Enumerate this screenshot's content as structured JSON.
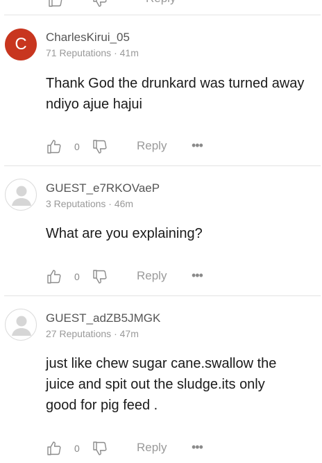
{
  "previous_comment": {
    "reply_label": "Reply"
  },
  "comments": [
    {
      "avatar_letter": "C",
      "avatar_color": "#c8361f",
      "username": "CharlesKirui_05",
      "meta": "71 Reputations · 41m",
      "text_lines": [
        "Thank God the drunkard was turned away",
        "ndiyo ajue hajui"
      ],
      "like_count": "0",
      "reply_label": "Reply",
      "more_label": "•••"
    },
    {
      "avatar_letter": "",
      "username": "GUEST_e7RKOVaeP",
      "meta": "3 Reputations · 46m",
      "text_lines": [
        "What are you explaining?"
      ],
      "like_count": "0",
      "reply_label": "Reply",
      "more_label": "•••"
    },
    {
      "avatar_letter": "",
      "username": "GUEST_adZB5JMGK",
      "meta": "27 Reputations · 47m",
      "text_lines": [
        "just like chew sugar cane.swallow the",
        "juice and spit out the sludge.its only",
        "good for pig feed ."
      ],
      "like_count": "0",
      "reply_label": "Reply",
      "more_label": "•••"
    }
  ]
}
